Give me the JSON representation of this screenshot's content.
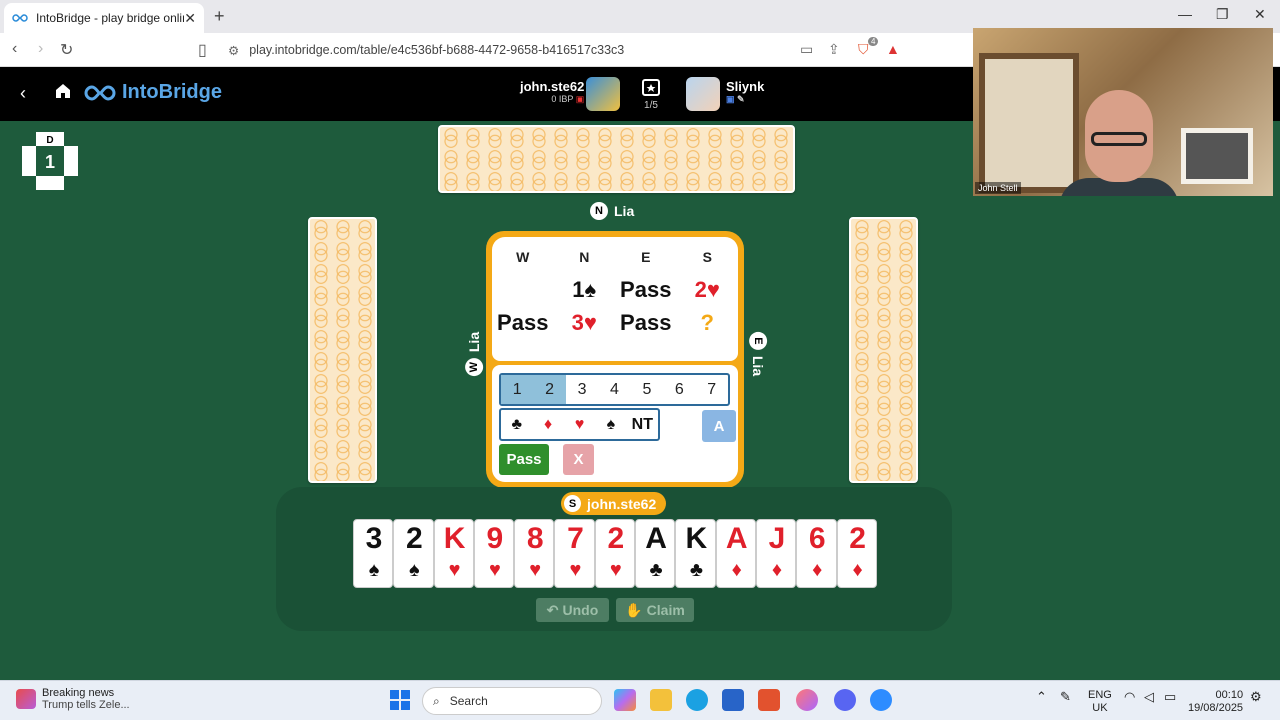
{
  "browser": {
    "tab_title": "IntoBridge - play bridge online",
    "url": "play.intobridge.com/table/e4c536bf-b688-4472-9658-b416517c33c3",
    "extension_badge": "4"
  },
  "header": {
    "brand": "IntoBridge",
    "player_name": "john.ste62",
    "player_rating": "0 IBP",
    "board_progress": "1/5",
    "opponent_name": "Sliynk"
  },
  "webcam": {
    "label": "John Stell"
  },
  "table": {
    "dealer_label": "D",
    "board_number": "1",
    "north": {
      "seat": "N",
      "name": "Lia"
    },
    "west": {
      "seat": "W",
      "name": "Lia"
    },
    "east": {
      "seat": "E",
      "name": "Lia"
    },
    "south": {
      "seat": "S",
      "name": "john.ste62"
    }
  },
  "auction": {
    "headers": [
      "W",
      "N",
      "E",
      "S"
    ],
    "row1": [
      "",
      "1♠",
      "Pass",
      "2♥"
    ],
    "row2": [
      "Pass",
      "3♥",
      "Pass",
      "?"
    ]
  },
  "bidding_box": {
    "levels": [
      "1",
      "2",
      "3",
      "4",
      "5",
      "6",
      "7"
    ],
    "strains": [
      "♣",
      "♦",
      "♥",
      "♠",
      "NT"
    ],
    "alert": "A",
    "pass": "Pass",
    "double": "X"
  },
  "hand": [
    {
      "rank": "3",
      "suit": "♠",
      "color": "black"
    },
    {
      "rank": "2",
      "suit": "♠",
      "color": "black"
    },
    {
      "rank": "K",
      "suit": "♥",
      "color": "red"
    },
    {
      "rank": "9",
      "suit": "♥",
      "color": "red"
    },
    {
      "rank": "8",
      "suit": "♥",
      "color": "red"
    },
    {
      "rank": "7",
      "suit": "♥",
      "color": "red"
    },
    {
      "rank": "2",
      "suit": "♥",
      "color": "red"
    },
    {
      "rank": "A",
      "suit": "♣",
      "color": "black"
    },
    {
      "rank": "K",
      "suit": "♣",
      "color": "black"
    },
    {
      "rank": "A",
      "suit": "♦",
      "color": "red"
    },
    {
      "rank": "J",
      "suit": "♦",
      "color": "red"
    },
    {
      "rank": "6",
      "suit": "♦",
      "color": "red"
    },
    {
      "rank": "2",
      "suit": "♦",
      "color": "red"
    }
  ],
  "actions": {
    "undo": "Undo",
    "claim": "Claim"
  },
  "taskbar": {
    "news_title": "Breaking news",
    "news_sub": "Trump tells Zele...",
    "search": "Search",
    "lang1": "ENG",
    "lang2": "UK",
    "time": "00:10",
    "date": "19/08/2025"
  }
}
